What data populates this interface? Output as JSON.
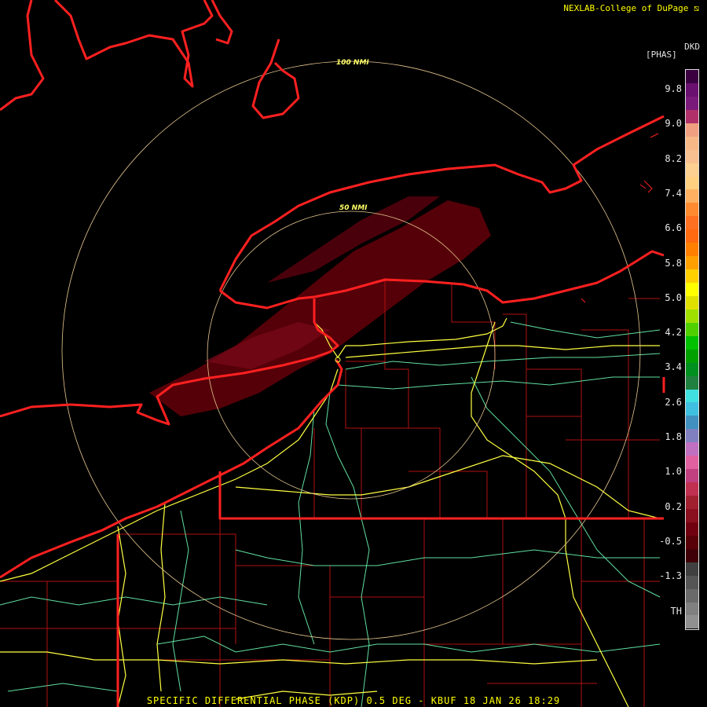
{
  "credit": "NEXLAB-College of DuPage",
  "product_code": "DKD",
  "unit": "[PHAS]",
  "footer": "SPECIFIC DIFFERENTIAL PHASE (KDP) 0.5 DEG - KBUF 18 JAN 26 18:29",
  "range_rings": {
    "inner": "50 NMI",
    "outer": "100 NMI"
  },
  "legend": {
    "ticks": [
      "9.8",
      "9.0",
      "8.2",
      "7.4",
      "6.6",
      "5.8",
      "5.0",
      "4.2",
      "3.4",
      "2.6",
      "1.8",
      "1.0",
      "0.2",
      "-0.5",
      "-1.3",
      "TH"
    ],
    "colors": [
      "#3a0040",
      "#6a1070",
      "#7a1a7a",
      "#b0306a",
      "#f0a080",
      "#f7b888",
      "#f8c090",
      "#fbd090",
      "#ffd080",
      "#ffb060",
      "#ff8a30",
      "#ff7020",
      "#ff6a10",
      "#ff8000",
      "#ffa000",
      "#ffd000",
      "#ffff00",
      "#e0e000",
      "#a0e000",
      "#50d000",
      "#00c000",
      "#00a000",
      "#009020",
      "#208040",
      "#40e0e0",
      "#40c0e0",
      "#4090c0",
      "#8080c0",
      "#c070c0",
      "#e060a0",
      "#c04080",
      "#c03050",
      "#a02030",
      "#8a1020",
      "#700010",
      "#580008",
      "#400008",
      "#404040",
      "#555555",
      "#6a6a6a",
      "#808080",
      "#909090"
    ]
  },
  "colors": {
    "background": "#000000",
    "lake_shore": "#ff2020",
    "county_lines": "#b01010",
    "highways_major": "#ffff40",
    "highways_minor": "#60e0a0",
    "range_ring": "#e8c890",
    "echo": "#5a0008"
  },
  "icons": [
    "nexlab-logo-icon"
  ]
}
